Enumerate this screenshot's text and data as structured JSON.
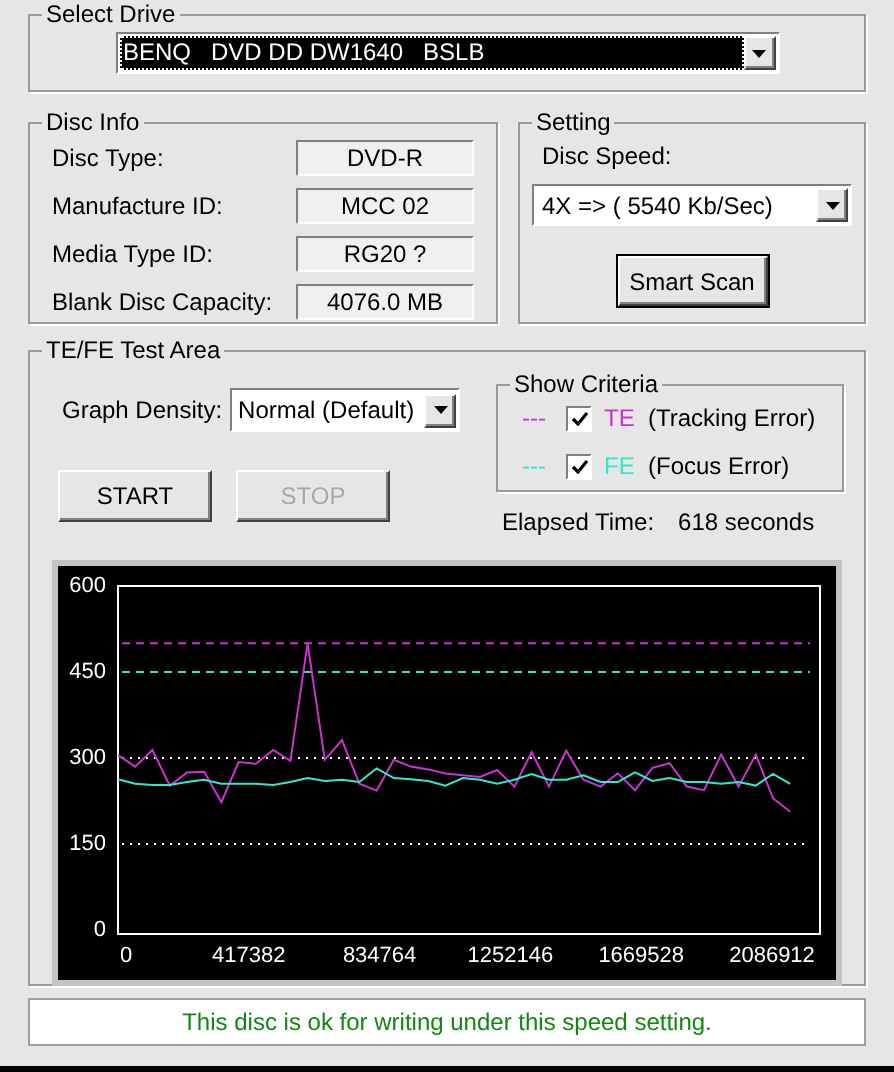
{
  "select_drive": {
    "title": "Select Drive",
    "drive": "BENQ   DVD DD DW1640   BSLB"
  },
  "disc_info": {
    "title": "Disc Info",
    "fields": [
      {
        "label": "Disc Type:",
        "value": "DVD-R"
      },
      {
        "label": "Manufacture ID:",
        "value": "MCC 02"
      },
      {
        "label": "Media Type ID:",
        "value": "RG20 ?"
      },
      {
        "label": "Blank Disc Capacity:",
        "value": "4076.0 MB"
      }
    ]
  },
  "setting": {
    "title": "Setting",
    "speed_label": "Disc Speed:",
    "speed": "4X => ( 5540 Kb/Sec)",
    "button": "Smart Scan"
  },
  "test_area": {
    "title": "TE/FE Test Area",
    "density_label": "Graph Density:",
    "density": "Normal (Default)",
    "buttons": [
      {
        "label": "START",
        "disabled": false
      },
      {
        "label": "STOP",
        "disabled": true
      }
    ],
    "criteria": {
      "title": "Show Criteria",
      "items": [
        {
          "marker": "---",
          "label": "(Tracking Error)",
          "checked": true
        },
        {
          "marker": "---",
          "label": "(Focus Error)",
          "checked": true
        }
      ]
    },
    "elapsed_label": "Elapsed Time:",
    "elapsed": "618 seconds",
    "chart_data": {
      "type": "line",
      "xlim": [
        0,
        2240000
      ],
      "ylim": [
        0,
        600
      ],
      "yticks": [
        0,
        150,
        300,
        450,
        600
      ],
      "xticks": [
        0,
        417382,
        834764,
        1252146,
        1669528,
        2086912
      ],
      "x": [
        0,
        55000,
        110000,
        165000,
        220000,
        275000,
        330000,
        385000,
        440000,
        495000,
        550000,
        605000,
        660000,
        715000,
        770000,
        825000,
        880000,
        935000,
        990000,
        1045000,
        1100000,
        1155000,
        1210000,
        1265000,
        1320000,
        1375000,
        1430000,
        1485000,
        1540000,
        1595000,
        1650000,
        1705000,
        1760000,
        1815000,
        1870000,
        1925000,
        1980000,
        2035000,
        2090000,
        2145000
      ],
      "series": [
        {
          "name": "TE",
          "color": "#cc33cc",
          "values": [
            305,
            285,
            314,
            252,
            275,
            276,
            223,
            293,
            290,
            314,
            295,
            500,
            297,
            331,
            255,
            243,
            297,
            285,
            280,
            273,
            270,
            267,
            279,
            250,
            310,
            250,
            313,
            262,
            250,
            273,
            244,
            283,
            291,
            250,
            244,
            306,
            250,
            306,
            230,
            206
          ]
        },
        {
          "name": "FE",
          "color": "#33e6cc",
          "values": [
            263,
            255,
            253,
            253,
            258,
            262,
            255,
            255,
            255,
            253,
            258,
            265,
            260,
            262,
            258,
            282,
            265,
            263,
            260,
            252,
            265,
            262,
            255,
            262,
            272,
            262,
            262,
            270,
            258,
            258,
            275,
            260,
            265,
            258,
            258,
            255,
            258,
            252,
            272,
            255
          ]
        }
      ],
      "ref_lines": [
        {
          "axis": "y",
          "value": 500,
          "color": "#cc33cc"
        },
        {
          "axis": "y",
          "value": 450,
          "color": "#33e6cc"
        },
        {
          "axis": "y",
          "value": 300,
          "color": "#ffffff"
        },
        {
          "axis": "y",
          "value": 150,
          "color": "#ffffff"
        }
      ]
    }
  },
  "status": "This disc is ok for writing under this speed setting."
}
